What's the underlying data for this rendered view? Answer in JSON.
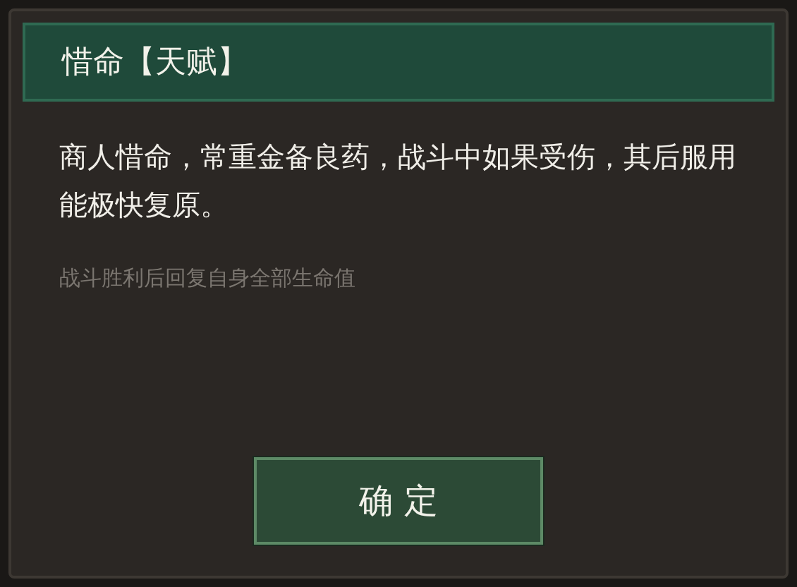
{
  "dialog": {
    "title": "惜命【天赋】",
    "description": "商人惜命，常重金备良药，战斗中如果受伤，其后服用能极快复原。",
    "effect": "战斗胜利后回复自身全部生命值",
    "buttons": [
      {
        "label": "确 定"
      }
    ]
  }
}
